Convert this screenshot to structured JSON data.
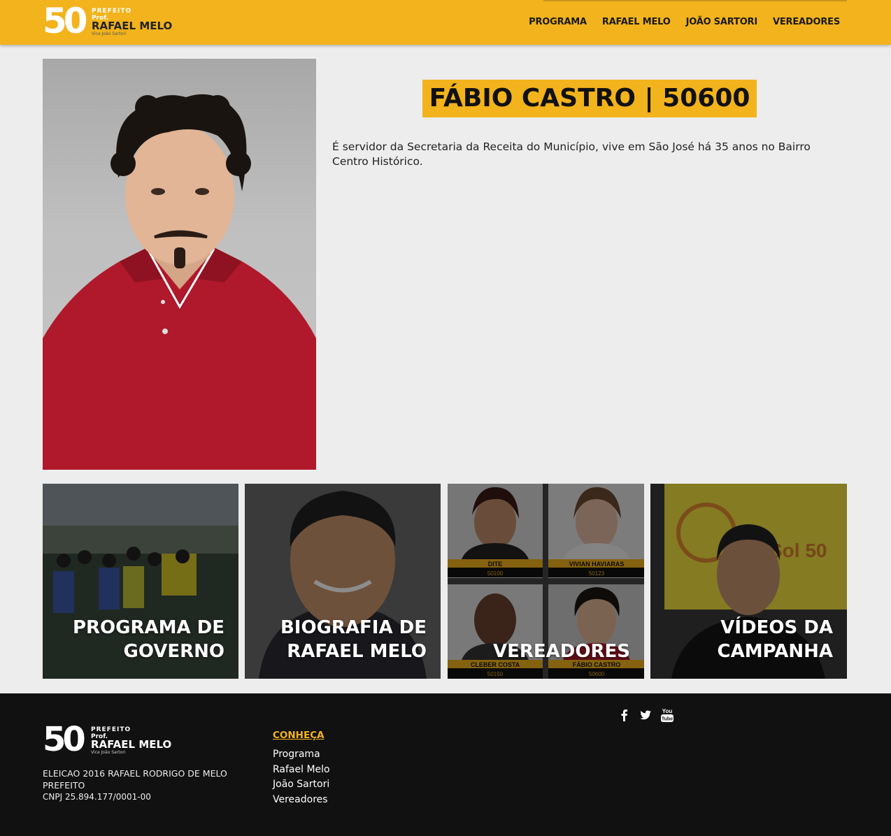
{
  "header": {
    "logo": {
      "number": "50",
      "prefix": "PREFEITO",
      "prof": "Prof.",
      "name": "RAFAEL MELO",
      "vice": "Vice João Sartori"
    },
    "nav": [
      "PROGRAMA",
      "RAFAEL MELO",
      "JOÃO SARTORI",
      "VEREADORES"
    ]
  },
  "profile": {
    "title": "FÁBIO CASTRO | 50600",
    "bio": "É servidor da Secretaria da Receita do Município, vive em São José há 35 anos no Bairro Centro Histórico."
  },
  "tiles": [
    {
      "label": "PROGRAMA DE\nGOVERNO"
    },
    {
      "label": "BIOGRAFIA DE\nRAFAEL MELO"
    },
    {
      "label": "VEREADORES",
      "candidates": [
        {
          "name": "DITE",
          "number": "50100"
        },
        {
          "name": "VIVIAN HAVIARAS",
          "number": "50123"
        },
        {
          "name": "CLEBER COSTA",
          "number": "50150"
        },
        {
          "name": "FÁBIO CASTRO",
          "number": "50600"
        }
      ]
    },
    {
      "label": "VÍDEOS DA\nCAMPANHA",
      "banner_text": "Sol 50"
    }
  ],
  "footer": {
    "logo": {
      "number": "50",
      "prefix": "PREFEITO",
      "prof": "Prof.",
      "name": "RAFAEL MELO",
      "vice": "Vice João Sartori"
    },
    "info_line1": "ELEICAO 2016 RAFAEL RODRIGO DE MELO PREFEITO",
    "info_line2": "CNPJ 25.894.177/0001-00",
    "conheca": "CONHEÇA",
    "links": [
      "Programa",
      "Rafael Melo",
      "João Sartori",
      "Vereadores"
    ],
    "social_icons": [
      "facebook-icon",
      "twitter-icon",
      "youtube-icon"
    ],
    "youtube_text": "You Tube"
  },
  "colors": {
    "accent": "#f2b31c",
    "footer_bg": "#111111",
    "page_bg": "#ededed"
  }
}
